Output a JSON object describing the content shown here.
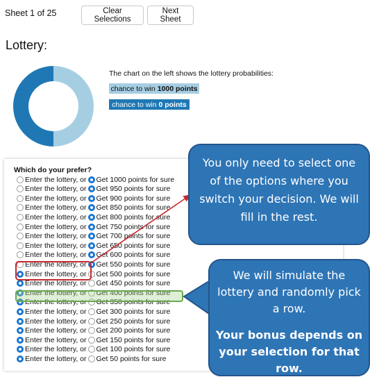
{
  "header": {
    "sheet_label": "Sheet 1 of 25",
    "clear_button": "Clear Selections",
    "next_button": "Next Sheet"
  },
  "lottery": {
    "title": "Lottery:",
    "description": "The chart on the left shows the lottery probabilities:",
    "legend": [
      {
        "prefix": "chance to win",
        "bold": "1000 points",
        "color": "#a6cee3"
      },
      {
        "prefix": "chance to win",
        "bold": "0 points",
        "color": "#1f78b4"
      }
    ],
    "chart_data": {
      "type": "pie",
      "labels": [
        "chance to win 1000 points",
        "chance to win 0 points"
      ],
      "values": [
        50,
        50
      ],
      "colors": [
        "#a6cee3",
        "#1f78b4"
      ]
    }
  },
  "choices": {
    "question": "Which do your prefer?",
    "lottery_option": "Enter the lottery, or",
    "rows": [
      {
        "sure": "Get 1000 points for sure",
        "selected": "sure"
      },
      {
        "sure": "Get 950 points for sure",
        "selected": "sure"
      },
      {
        "sure": "Get 900 points for sure",
        "selected": "sure"
      },
      {
        "sure": "Get 850 points for sure",
        "selected": "sure"
      },
      {
        "sure": "Get 800 points for sure",
        "selected": "sure"
      },
      {
        "sure": "Get 750 points for sure",
        "selected": "sure"
      },
      {
        "sure": "Get 700 points for sure",
        "selected": "sure"
      },
      {
        "sure": "Get 650 points for sure",
        "selected": "sure"
      },
      {
        "sure": "Get 600 points for sure",
        "selected": "sure"
      },
      {
        "sure": "Get 550 points for sure",
        "selected": "sure"
      },
      {
        "sure": "Get 500 points for sure",
        "selected": "lottery"
      },
      {
        "sure": "Get 450 points for sure",
        "selected": "lottery"
      },
      {
        "sure": "Get 400 points for sure",
        "selected": "lottery"
      },
      {
        "sure": "Get 350 points for sure",
        "selected": "lottery"
      },
      {
        "sure": "Get 300 points for sure",
        "selected": "lottery"
      },
      {
        "sure": "Get 250 points for sure",
        "selected": "lottery"
      },
      {
        "sure": "Get 200 points for sure",
        "selected": "lottery"
      },
      {
        "sure": "Get 150 points for sure",
        "selected": "lottery"
      },
      {
        "sure": "Get 100 points for sure",
        "selected": "lottery"
      },
      {
        "sure": "Get 50 points for sure",
        "selected": "lottery"
      }
    ]
  },
  "callouts": {
    "switch": "You only need to select one of the options where you switch your decision. We will fill in the rest.",
    "simulate": "We will simulate the lottery and randomly pick a row.",
    "bonus": "Your bonus depends on your selection for that row."
  },
  "colors": {
    "accent": "#1976d2",
    "callout": "#2e75b6",
    "highlight_red": "#c6282f",
    "highlight_green": "#6aa84f"
  }
}
